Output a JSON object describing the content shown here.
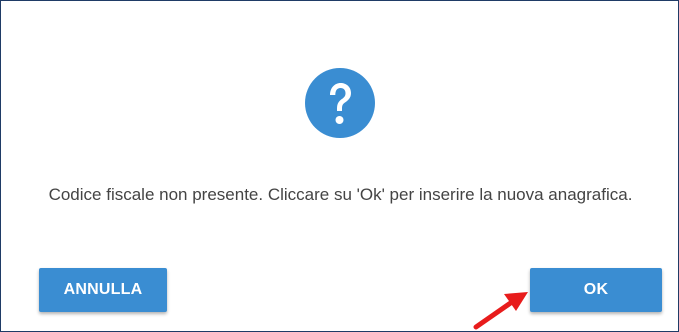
{
  "dialog": {
    "icon": "question-mark-icon",
    "message": "Codice fiscale non presente. Cliccare su 'Ok' per inserire la nuova anagrafica.",
    "cancel_label": "ANNULLA",
    "ok_label": "OK"
  },
  "annotation": {
    "arrow_icon": "red-pointer-arrow-icon",
    "arrow_color": "#e81c1c"
  },
  "colors": {
    "accent": "#3a8dd2",
    "border": "#1f3b66",
    "text": "#444444"
  }
}
